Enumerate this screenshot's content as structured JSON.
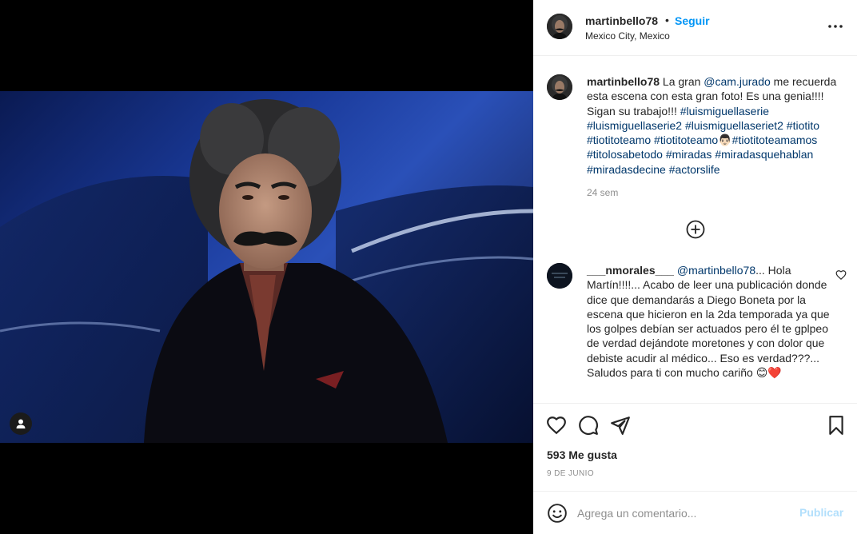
{
  "post": {
    "author": "martinbello78",
    "follow_label": "Seguir",
    "location": "Mexico City, Mexico",
    "separator": "•"
  },
  "caption": {
    "username": "martinbello78",
    "text_before": " La gran ",
    "mention": "@cam.jurado",
    "text_after": " me recuerda esta escena con esta gran foto! Es una genia!!!! Sigan su trabajo!!! ",
    "hashtags_line1": "#luismiguellaserie",
    "hashtags_line2": "#luismiguellaserie2 #luismiguellaseriet2 #tiotito",
    "hashtags_line3a": "#tiotitoteamo #tiotitoteamo",
    "emoji": "👨🏻",
    "hashtags_line3b": "#tiotitoteamamos",
    "hashtags_line4": "#titolosabetodo #miradas #miradasquehablan",
    "hashtags_line5": "#miradasdecine #actorslife",
    "time": "24 sem"
  },
  "comment": {
    "username": "___nmorales___",
    "mention": "@martinbello78",
    "text": "... Hola Martín!!!!... Acabo de leer una publicación donde dice que demandarás a Diego Boneta por la escena que hicieron en la 2da temporada ya que los golpes debían ser actuados pero él te gplpeo de verdad dejándote moretones y con dolor que debiste acudir al médico... Eso es verdad???... Saludos para ti con mucho cariño ",
    "emojis": "😊❤️"
  },
  "stats": {
    "likes": "593 Me gusta",
    "date": "9 DE JUNIO"
  },
  "composer": {
    "placeholder": "Agrega un comentario...",
    "post_label": "Publicar"
  },
  "icons": {
    "more": "more-options-icon",
    "load_more": "load-more-comments-icon",
    "like": "heart-icon",
    "comment": "comment-icon",
    "share": "share-icon",
    "save": "bookmark-icon",
    "emoji": "emoji-icon",
    "tag": "user-tag-icon"
  },
  "colors": {
    "link": "#00376b",
    "follow": "#0095f6",
    "post_disabled": "#b2dffc",
    "muted": "#8e8e8e"
  }
}
